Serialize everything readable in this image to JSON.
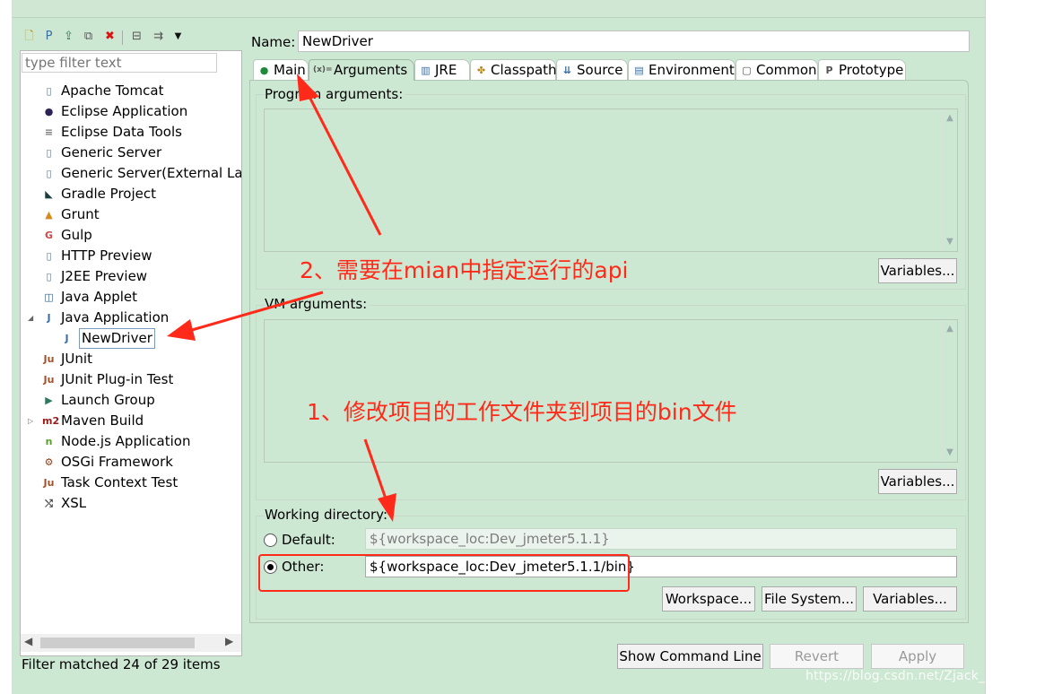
{
  "left_panel": {
    "filter_placeholder": "type filter text",
    "tree": [
      {
        "label": "Apache Tomcat",
        "icon": "server-icon",
        "glyph": "▯",
        "color": "#5a6f85"
      },
      {
        "label": "Eclipse Application",
        "icon": "eclipse-icon",
        "glyph": "●",
        "color": "#2c2255"
      },
      {
        "label": "Eclipse Data Tools",
        "icon": "database-icon",
        "glyph": "≡",
        "color": "#777777"
      },
      {
        "label": "Generic Server",
        "icon": "server-icon",
        "glyph": "▯",
        "color": "#5a6f85"
      },
      {
        "label": "Generic Server(External Launch)",
        "icon": "server-icon",
        "glyph": "▯",
        "color": "#5a6f85"
      },
      {
        "label": "Gradle Project",
        "icon": "gradle-icon",
        "glyph": "◣",
        "color": "#1c3d3f"
      },
      {
        "label": "Grunt",
        "icon": "grunt-icon",
        "glyph": "▲",
        "color": "#d48a1a"
      },
      {
        "label": "Gulp",
        "icon": "gulp-icon",
        "glyph": "G",
        "color": "#cf4647"
      },
      {
        "label": "HTTP Preview",
        "icon": "server-icon",
        "glyph": "▯",
        "color": "#5a6f85"
      },
      {
        "label": "J2EE Preview",
        "icon": "server-icon",
        "glyph": "▯",
        "color": "#5a6f85"
      },
      {
        "label": "Java Applet",
        "icon": "applet-icon",
        "glyph": "◫",
        "color": "#2e5d8a"
      },
      {
        "label": "Java Application",
        "icon": "java-app-icon",
        "glyph": "J",
        "color": "#3a6ea5",
        "expanded": true
      },
      {
        "label": "NewDriver",
        "icon": "java-app-icon",
        "glyph": "J",
        "color": "#3a6ea5",
        "child": true,
        "selected": true
      },
      {
        "label": "JUnit",
        "icon": "junit-icon",
        "glyph": "Ju",
        "color": "#a0522d"
      },
      {
        "label": "JUnit Plug-in Test",
        "icon": "junit-plugin-icon",
        "glyph": "Ju",
        "color": "#a0522d"
      },
      {
        "label": "Launch Group",
        "icon": "launch-group-icon",
        "glyph": "▶",
        "color": "#2e7a5a"
      },
      {
        "label": "Maven Build",
        "icon": "maven-icon",
        "glyph": "m2",
        "color": "#9b1b1b",
        "collapsed": true
      },
      {
        "label": "Node.js Application",
        "icon": "nodejs-icon",
        "glyph": "n",
        "color": "#5a9e2f"
      },
      {
        "label": "OSGi Framework",
        "icon": "osgi-icon",
        "glyph": "⚙",
        "color": "#8a3c1f"
      },
      {
        "label": "Task Context Test",
        "icon": "task-icon",
        "glyph": "Ju",
        "color": "#a0522d"
      },
      {
        "label": "XSL",
        "icon": "xsl-icon",
        "glyph": "⤭",
        "color": "#444444"
      }
    ],
    "status": "Filter matched 24 of 29 items"
  },
  "right_panel": {
    "name_label": "Name:",
    "name_value": "NewDriver",
    "tabs": [
      {
        "label": "Main",
        "icon": "main-tab-icon",
        "glyph": "●",
        "color": "#1f8a3a"
      },
      {
        "label": "Arguments",
        "icon": "arguments-tab-icon",
        "glyph": "(x)=",
        "color": "#555555",
        "active": true
      },
      {
        "label": "JRE",
        "icon": "jre-tab-icon",
        "glyph": "▥",
        "color": "#3a6ea5"
      },
      {
        "label": "Classpath",
        "icon": "classpath-tab-icon",
        "glyph": "✤",
        "color": "#b58a1a"
      },
      {
        "label": "Source",
        "icon": "source-tab-icon",
        "glyph": "⇊",
        "color": "#3a6ea5"
      },
      {
        "label": "Environment",
        "icon": "environment-tab-icon",
        "glyph": "▤",
        "color": "#3a6ea5"
      },
      {
        "label": "Common",
        "icon": "common-tab-icon",
        "glyph": "▢",
        "color": "#555555"
      },
      {
        "label": "Prototype",
        "icon": "prototype-tab-icon",
        "glyph": "P",
        "color": "#555555"
      }
    ],
    "program_arguments_label": "Program arguments:",
    "vm_arguments_label": "VM arguments:",
    "variables_label": "Variables...",
    "working_directory_label": "Working directory:",
    "default_label": "Default:",
    "default_value": "${workspace_loc:Dev_jmeter5.1.1}",
    "other_label": "Other:",
    "other_value": "${workspace_loc:Dev_jmeter5.1.1/bin}",
    "workspace_button": "Workspace...",
    "file_system_button": "File System...",
    "show_command_line": "Show Command Line",
    "revert": "Revert",
    "apply": "Apply"
  },
  "annotations": {
    "note1": "1、修改项目的工作文件夹到项目的bin文件",
    "note2": "2、需要在mian中指定运行的api",
    "arrow_color": "#ff2a1a"
  },
  "watermark": "https://blog.csdn.net/Zjack_understands"
}
